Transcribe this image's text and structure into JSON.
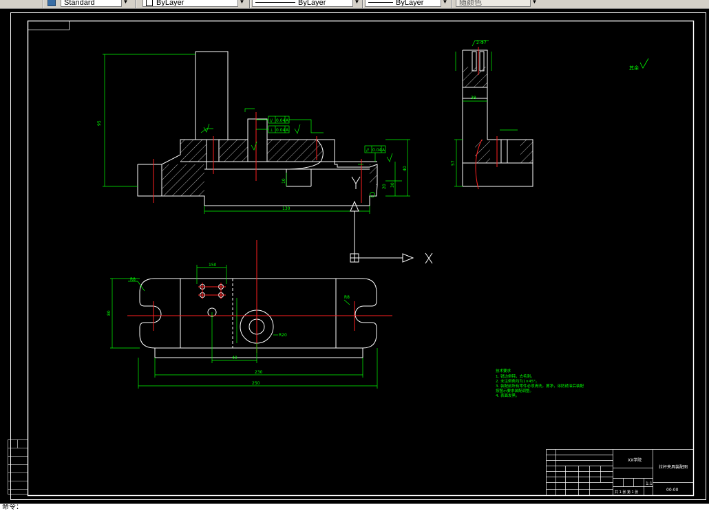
{
  "toolbar": {
    "textstyle": "Standard",
    "layer": "ByLayer",
    "linetype": "ByLayer",
    "lineweight": "ByLayer",
    "plotstyle": "随颜色"
  },
  "drawing": {
    "axis_x": "X",
    "axis_y": "Y",
    "roughness_symbol": "其余",
    "dims": {
      "front_height": "95",
      "front_base_width": "130",
      "front_slot_depth": "10",
      "front_right_h1": "20",
      "front_right_h2": "30",
      "front_right_h3": "40",
      "tol_1_sym": "//",
      "tol_1_val": "0.04",
      "tol_1_ref": "A",
      "tol_2_sym": "⊥",
      "tol_2_val": "0.04",
      "tol_2_ref": "A",
      "tol_3_sym": "//",
      "tol_3_val": "0.04",
      "tol_3_ref": "A",
      "side_width": "38",
      "side_height": "57",
      "side_hole": "2-Φ7",
      "top_plan_depth": "R8",
      "top_length": "250",
      "top_inner": "230",
      "top_mid": "150",
      "top_height": "80",
      "top_holes": "40",
      "top_r": "R20",
      "top_slot_r": "R8"
    },
    "tech_req": {
      "title": "技术要求",
      "lines": [
        "1. 锐边倒钝，去毛刺。",
        "2. 未注倒角均为1×45°。",
        "3. 装配前所有零件必须清洗，擦净，涂防锈油后装配",
        "按图示要求装配调整。",
        "4. 表面发黑。"
      ]
    },
    "title_block": {
      "school": "XX学院",
      "name": "拉杆夹具装配图",
      "drawing_no": "00-00",
      "scale": "1:1",
      "sheet": "共 1 张 第 1 张"
    }
  },
  "command": {
    "prompt": "命令："
  }
}
